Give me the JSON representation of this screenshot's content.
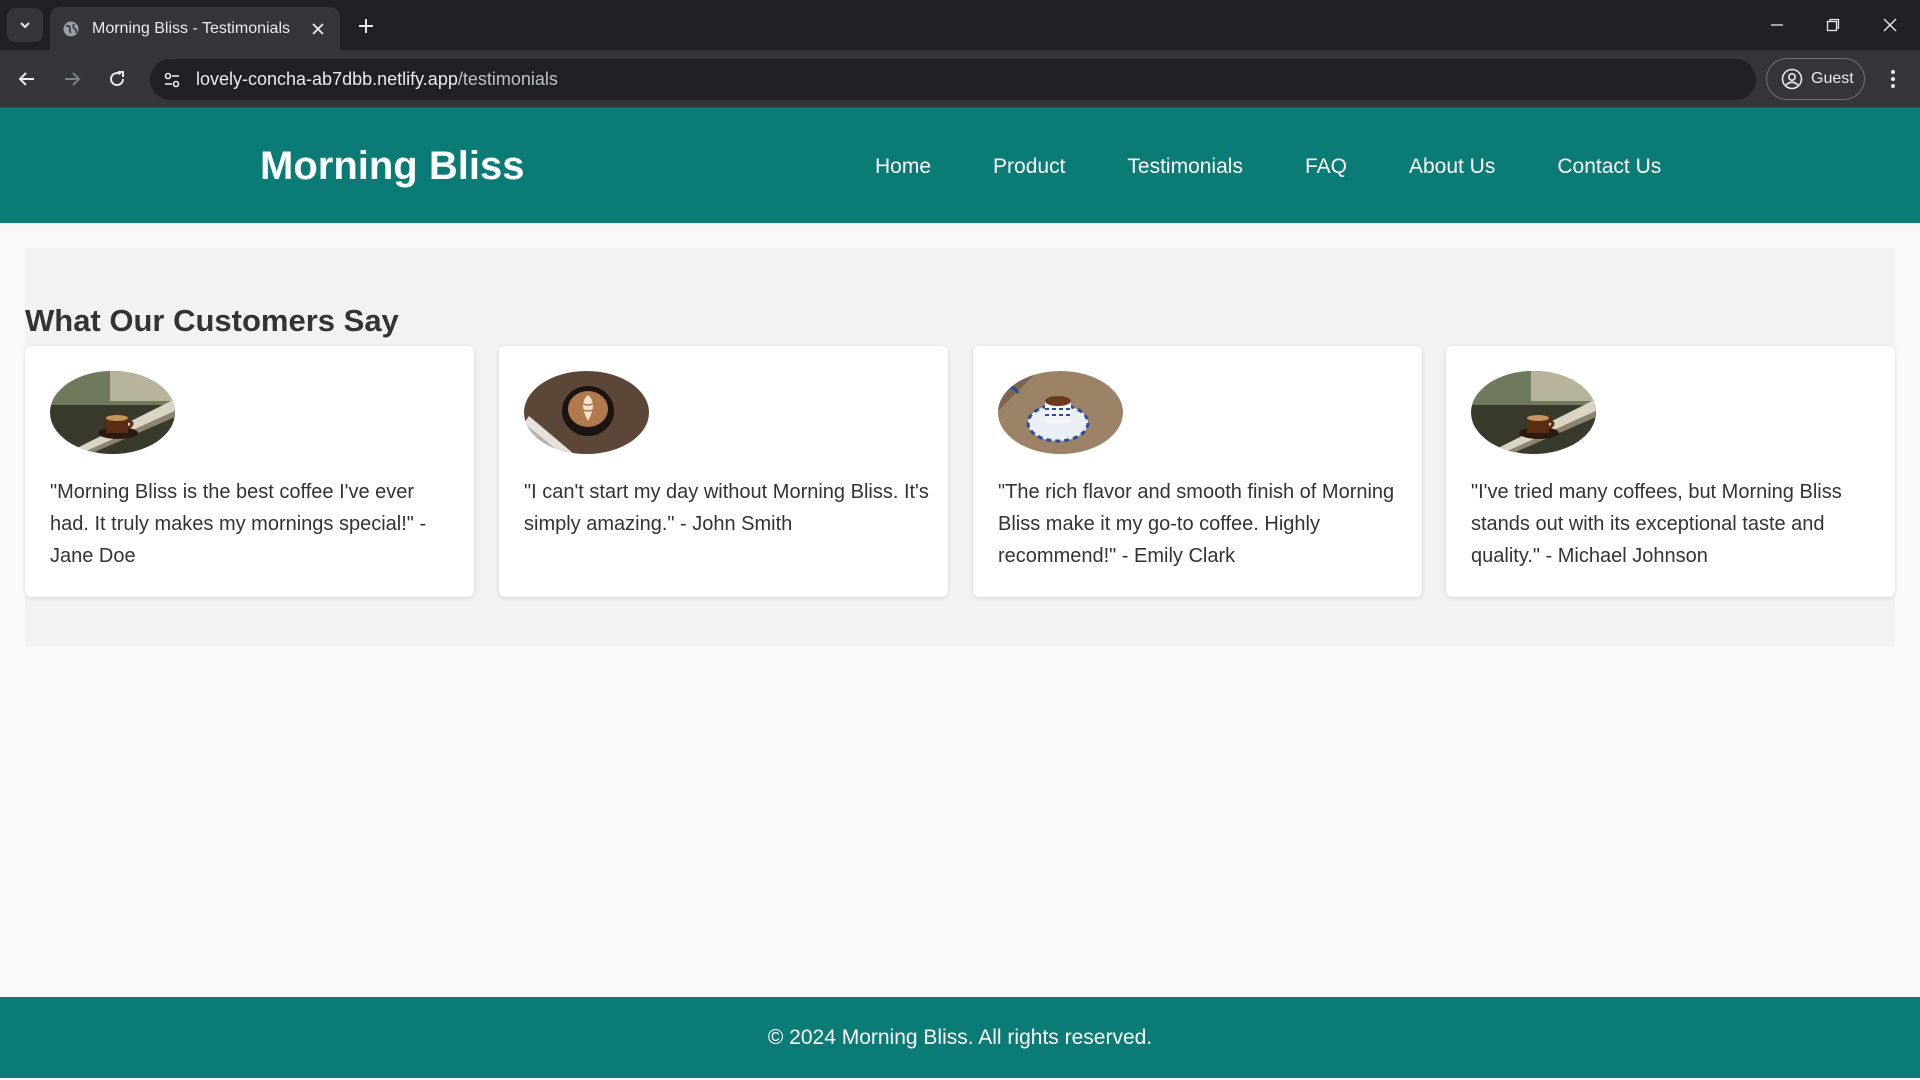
{
  "browser": {
    "tab_title": "Morning Bliss - Testimonials",
    "url_host": "lovely-concha-ab7dbb.netlify.app",
    "url_path": "/testimonials",
    "profile_label": "Guest"
  },
  "site": {
    "brand": "Morning Bliss",
    "nav": [
      "Home",
      "Product",
      "Testimonials",
      "FAQ",
      "About Us",
      "Contact Us"
    ],
    "section_title": "What Our Customers Say",
    "testimonials": [
      {
        "quote": "\"Morning Bliss is the best coffee I've ever had. It truly makes my mornings special!\" - Jane Doe",
        "photo": "coffee-cup-window-photo"
      },
      {
        "quote": "\"I can't start my day without Morning Bliss. It's simply amazing.\" - John Smith",
        "photo": "latte-art-cup-photo"
      },
      {
        "quote": "\"The rich flavor and smooth finish of Morning Bliss make it my go-to coffee. Highly recommend!\" - Emily Clark",
        "photo": "blue-patterned-cup-photo"
      },
      {
        "quote": "\"I've tried many coffees, but Morning Bliss stands out with its exceptional taste and quality.\" - Michael Johnson",
        "photo": "coffee-cup-window-photo"
      }
    ],
    "footer": "© 2024 Morning Bliss. All rights reserved."
  },
  "colors": {
    "brand_teal": "#0b7b76",
    "chrome_dark": "#202124",
    "chrome_toolbar": "#35363a",
    "page_bg": "#f9f9f9",
    "section_bg": "#f2f2f2",
    "text": "#333333"
  }
}
